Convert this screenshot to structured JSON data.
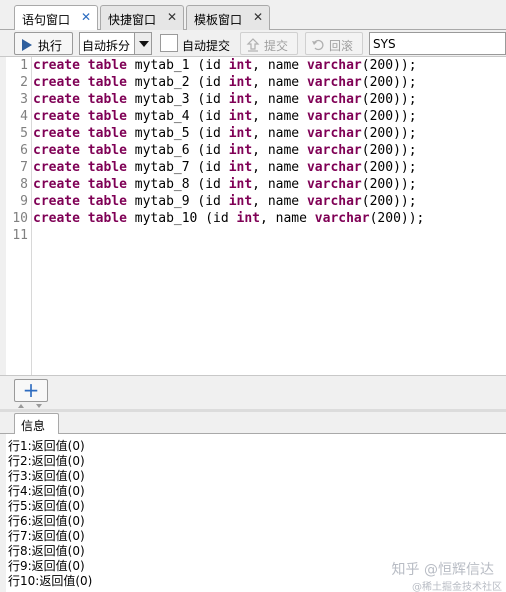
{
  "tabs": [
    {
      "label": "语句窗口",
      "active": true
    },
    {
      "label": "快捷窗口",
      "active": false
    },
    {
      "label": "模板窗口",
      "active": false
    }
  ],
  "toolbar": {
    "execute_label": "执行",
    "split_select_value": "自动拆分",
    "autocommit_label": "自动提交",
    "submit_label": "提交",
    "rollback_label": "回滚",
    "schema_value": "SYS"
  },
  "editor": {
    "lines": [
      {
        "n": "1",
        "kw1": "create",
        "kw2": "table",
        "mid": " mytab_1 (id ",
        "kw3": "int",
        "mid2": ", name ",
        "kw4": "varchar",
        "tail": "(200));"
      },
      {
        "n": "2",
        "kw1": "create",
        "kw2": "table",
        "mid": " mytab_2 (id ",
        "kw3": "int",
        "mid2": ", name ",
        "kw4": "varchar",
        "tail": "(200));"
      },
      {
        "n": "3",
        "kw1": "create",
        "kw2": "table",
        "mid": " mytab_3 (id ",
        "kw3": "int",
        "mid2": ", name ",
        "kw4": "varchar",
        "tail": "(200));"
      },
      {
        "n": "4",
        "kw1": "create",
        "kw2": "table",
        "mid": " mytab_4 (id ",
        "kw3": "int",
        "mid2": ", name ",
        "kw4": "varchar",
        "tail": "(200));"
      },
      {
        "n": "5",
        "kw1": "create",
        "kw2": "table",
        "mid": " mytab_5 (id ",
        "kw3": "int",
        "mid2": ", name ",
        "kw4": "varchar",
        "tail": "(200));"
      },
      {
        "n": "6",
        "kw1": "create",
        "kw2": "table",
        "mid": " mytab_6 (id ",
        "kw3": "int",
        "mid2": ", name ",
        "kw4": "varchar",
        "tail": "(200));"
      },
      {
        "n": "7",
        "kw1": "create",
        "kw2": "table",
        "mid": " mytab_7 (id ",
        "kw3": "int",
        "mid2": ", name ",
        "kw4": "varchar",
        "tail": "(200));"
      },
      {
        "n": "8",
        "kw1": "create",
        "kw2": "table",
        "mid": " mytab_8 (id ",
        "kw3": "int",
        "mid2": ", name ",
        "kw4": "varchar",
        "tail": "(200));"
      },
      {
        "n": "9",
        "kw1": "create",
        "kw2": "table",
        "mid": " mytab_9 (id ",
        "kw3": "int",
        "mid2": ", name ",
        "kw4": "varchar",
        "tail": "(200));"
      },
      {
        "n": "10",
        "kw1": "create",
        "kw2": "table",
        "mid": " mytab_10 (id ",
        "kw3": "int",
        "mid2": ", name ",
        "kw4": "varchar",
        "tail": "(200));"
      },
      {
        "n": "11",
        "kw1": "",
        "kw2": "",
        "mid": "",
        "kw3": "",
        "mid2": "",
        "kw4": "",
        "tail": ""
      }
    ]
  },
  "add_button_label": "+",
  "info_tab_label": "信息",
  "output_rows": [
    "行1:返回值(0)",
    "行2:返回值(0)",
    "行3:返回值(0)",
    "行4:返回值(0)",
    "行5:返回值(0)",
    "行6:返回值(0)",
    "行7:返回值(0)",
    "行8:返回值(0)",
    "行9:返回值(0)",
    "行10:返回值(0)"
  ],
  "watermark": {
    "line1": "知乎 @恒辉信达",
    "line2": "@稀土掘金技术社区"
  },
  "colors": {
    "keyword": "#7f0055",
    "accent": "#2e6cc0"
  }
}
